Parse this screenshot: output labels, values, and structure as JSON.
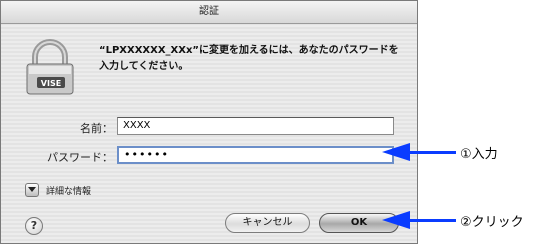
{
  "dialog": {
    "title": "認証",
    "message": "“LPXXXXXX_XXx”に変更を加えるには、あなたのパスワードを入力してください。",
    "lock_badge": "VISE",
    "name_label": "名前：",
    "name_value": "XXXX",
    "password_label": "パスワード：",
    "password_value": "••••••",
    "details_label": "詳細な情報",
    "help_label": "?",
    "cancel_label": "キャンセル",
    "ok_label": "OK"
  },
  "callouts": {
    "input_label": "①入力",
    "click_label": "②クリック"
  },
  "colors": {
    "callout_arrow": "#0a3cff",
    "field_focus": "#6c8fc9"
  }
}
